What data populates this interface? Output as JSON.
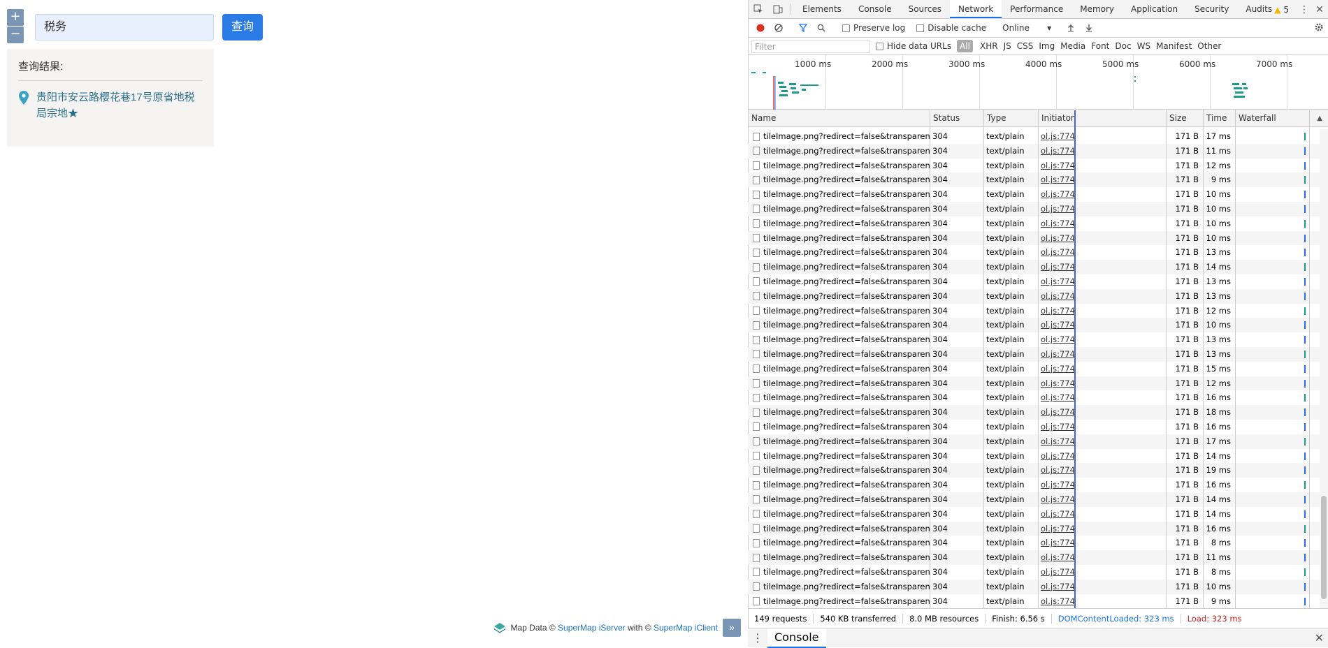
{
  "map": {
    "zoom_in": "+",
    "zoom_out": "−",
    "search_value": "税务",
    "search_button": "查询",
    "result_title": "查询结果:",
    "result_item": "贵阳市安云路樱花巷17号原省地税局宗地★",
    "attribution": {
      "prefix": "Map Data ©",
      "server": "SuperMap iServer",
      "with": "with ©",
      "client": "SuperMap iClient",
      "expand": "»"
    }
  },
  "devtools": {
    "tabs": [
      "Elements",
      "Console",
      "Sources",
      "Network",
      "Performance",
      "Memory",
      "Application",
      "Security",
      "Audits"
    ],
    "active_tab": "Network",
    "warnings": "5",
    "toolbar": {
      "preserve_log": "Preserve log",
      "disable_cache": "Disable cache",
      "throttle": "Online"
    },
    "filter": {
      "placeholder": "Filter",
      "hide_data_urls": "Hide data URLs",
      "types": [
        "All",
        "XHR",
        "JS",
        "CSS",
        "Img",
        "Media",
        "Font",
        "Doc",
        "WS",
        "Manifest",
        "Other"
      ]
    },
    "overview_labels": [
      "1000 ms",
      "2000 ms",
      "3000 ms",
      "4000 ms",
      "5000 ms",
      "6000 ms",
      "7000 ms"
    ],
    "columns": [
      "Name",
      "Status",
      "Type",
      "Initiator",
      "Size",
      "Time",
      "Waterfall"
    ],
    "rows": [
      {
        "name": "tileImage.png?redirect=false&transparent...",
        "status": "304",
        "type": "text/plain",
        "initiator": "ol.js:774",
        "size": "171 B",
        "time": "17 ms"
      },
      {
        "name": "tileImage.png?redirect=false&transparent...",
        "status": "304",
        "type": "text/plain",
        "initiator": "ol.js:774",
        "size": "171 B",
        "time": "11 ms"
      },
      {
        "name": "tileImage.png?redirect=false&transparent...",
        "status": "304",
        "type": "text/plain",
        "initiator": "ol.js:774",
        "size": "171 B",
        "time": "12 ms"
      },
      {
        "name": "tileImage.png?redirect=false&transparent...",
        "status": "304",
        "type": "text/plain",
        "initiator": "ol.js:774",
        "size": "171 B",
        "time": "9 ms"
      },
      {
        "name": "tileImage.png?redirect=false&transparent...",
        "status": "304",
        "type": "text/plain",
        "initiator": "ol.js:774",
        "size": "171 B",
        "time": "10 ms"
      },
      {
        "name": "tileImage.png?redirect=false&transparent...",
        "status": "304",
        "type": "text/plain",
        "initiator": "ol.js:774",
        "size": "171 B",
        "time": "10 ms"
      },
      {
        "name": "tileImage.png?redirect=false&transparent...",
        "status": "304",
        "type": "text/plain",
        "initiator": "ol.js:774",
        "size": "171 B",
        "time": "10 ms"
      },
      {
        "name": "tileImage.png?redirect=false&transparent...",
        "status": "304",
        "type": "text/plain",
        "initiator": "ol.js:774",
        "size": "171 B",
        "time": "10 ms"
      },
      {
        "name": "tileImage.png?redirect=false&transparent...",
        "status": "304",
        "type": "text/plain",
        "initiator": "ol.js:774",
        "size": "171 B",
        "time": "13 ms"
      },
      {
        "name": "tileImage.png?redirect=false&transparent...",
        "status": "304",
        "type": "text/plain",
        "initiator": "ol.js:774",
        "size": "171 B",
        "time": "14 ms"
      },
      {
        "name": "tileImage.png?redirect=false&transparent...",
        "status": "304",
        "type": "text/plain",
        "initiator": "ol.js:774",
        "size": "171 B",
        "time": "13 ms"
      },
      {
        "name": "tileImage.png?redirect=false&transparent...",
        "status": "304",
        "type": "text/plain",
        "initiator": "ol.js:774",
        "size": "171 B",
        "time": "13 ms"
      },
      {
        "name": "tileImage.png?redirect=false&transparent...",
        "status": "304",
        "type": "text/plain",
        "initiator": "ol.js:774",
        "size": "171 B",
        "time": "12 ms"
      },
      {
        "name": "tileImage.png?redirect=false&transparent...",
        "status": "304",
        "type": "text/plain",
        "initiator": "ol.js:774",
        "size": "171 B",
        "time": "10 ms"
      },
      {
        "name": "tileImage.png?redirect=false&transparent...",
        "status": "304",
        "type": "text/plain",
        "initiator": "ol.js:774",
        "size": "171 B",
        "time": "13 ms"
      },
      {
        "name": "tileImage.png?redirect=false&transparent...",
        "status": "304",
        "type": "text/plain",
        "initiator": "ol.js:774",
        "size": "171 B",
        "time": "13 ms"
      },
      {
        "name": "tileImage.png?redirect=false&transparent...",
        "status": "304",
        "type": "text/plain",
        "initiator": "ol.js:774",
        "size": "171 B",
        "time": "15 ms"
      },
      {
        "name": "tileImage.png?redirect=false&transparent...",
        "status": "304",
        "type": "text/plain",
        "initiator": "ol.js:774",
        "size": "171 B",
        "time": "12 ms"
      },
      {
        "name": "tileImage.png?redirect=false&transparent...",
        "status": "304",
        "type": "text/plain",
        "initiator": "ol.js:774",
        "size": "171 B",
        "time": "16 ms"
      },
      {
        "name": "tileImage.png?redirect=false&transparent...",
        "status": "304",
        "type": "text/plain",
        "initiator": "ol.js:774",
        "size": "171 B",
        "time": "18 ms"
      },
      {
        "name": "tileImage.png?redirect=false&transparent...",
        "status": "304",
        "type": "text/plain",
        "initiator": "ol.js:774",
        "size": "171 B",
        "time": "16 ms"
      },
      {
        "name": "tileImage.png?redirect=false&transparent...",
        "status": "304",
        "type": "text/plain",
        "initiator": "ol.js:774",
        "size": "171 B",
        "time": "17 ms"
      },
      {
        "name": "tileImage.png?redirect=false&transparent...",
        "status": "304",
        "type": "text/plain",
        "initiator": "ol.js:774",
        "size": "171 B",
        "time": "14 ms"
      },
      {
        "name": "tileImage.png?redirect=false&transparent...",
        "status": "304",
        "type": "text/plain",
        "initiator": "ol.js:774",
        "size": "171 B",
        "time": "19 ms"
      },
      {
        "name": "tileImage.png?redirect=false&transparent...",
        "status": "304",
        "type": "text/plain",
        "initiator": "ol.js:774",
        "size": "171 B",
        "time": "16 ms"
      },
      {
        "name": "tileImage.png?redirect=false&transparent...",
        "status": "304",
        "type": "text/plain",
        "initiator": "ol.js:774",
        "size": "171 B",
        "time": "14 ms"
      },
      {
        "name": "tileImage.png?redirect=false&transparent...",
        "status": "304",
        "type": "text/plain",
        "initiator": "ol.js:774",
        "size": "171 B",
        "time": "14 ms"
      },
      {
        "name": "tileImage.png?redirect=false&transparent...",
        "status": "304",
        "type": "text/plain",
        "initiator": "ol.js:774",
        "size": "171 B",
        "time": "16 ms"
      },
      {
        "name": "tileImage.png?redirect=false&transparent...",
        "status": "304",
        "type": "text/plain",
        "initiator": "ol.js:774",
        "size": "171 B",
        "time": "8 ms"
      },
      {
        "name": "tileImage.png?redirect=false&transparent...",
        "status": "304",
        "type": "text/plain",
        "initiator": "ol.js:774",
        "size": "171 B",
        "time": "11 ms"
      },
      {
        "name": "tileImage.png?redirect=false&transparent...",
        "status": "304",
        "type": "text/plain",
        "initiator": "ol.js:774",
        "size": "171 B",
        "time": "8 ms"
      },
      {
        "name": "tileImage.png?redirect=false&transparent...",
        "status": "304",
        "type": "text/plain",
        "initiator": "ol.js:774",
        "size": "171 B",
        "time": "10 ms"
      },
      {
        "name": "tileImage.png?redirect=false&transparent...",
        "status": "304",
        "type": "text/plain",
        "initiator": "ol.js:774",
        "size": "171 B",
        "time": "9 ms"
      }
    ],
    "status_bar": {
      "requests": "149 requests",
      "transferred": "540 KB transferred",
      "resources": "8.0 MB resources",
      "finish": "Finish: 6.56 s",
      "dom": "DOMContentLoaded: 323 ms",
      "load": "Load: 323 ms"
    },
    "drawer_tab": "Console"
  }
}
